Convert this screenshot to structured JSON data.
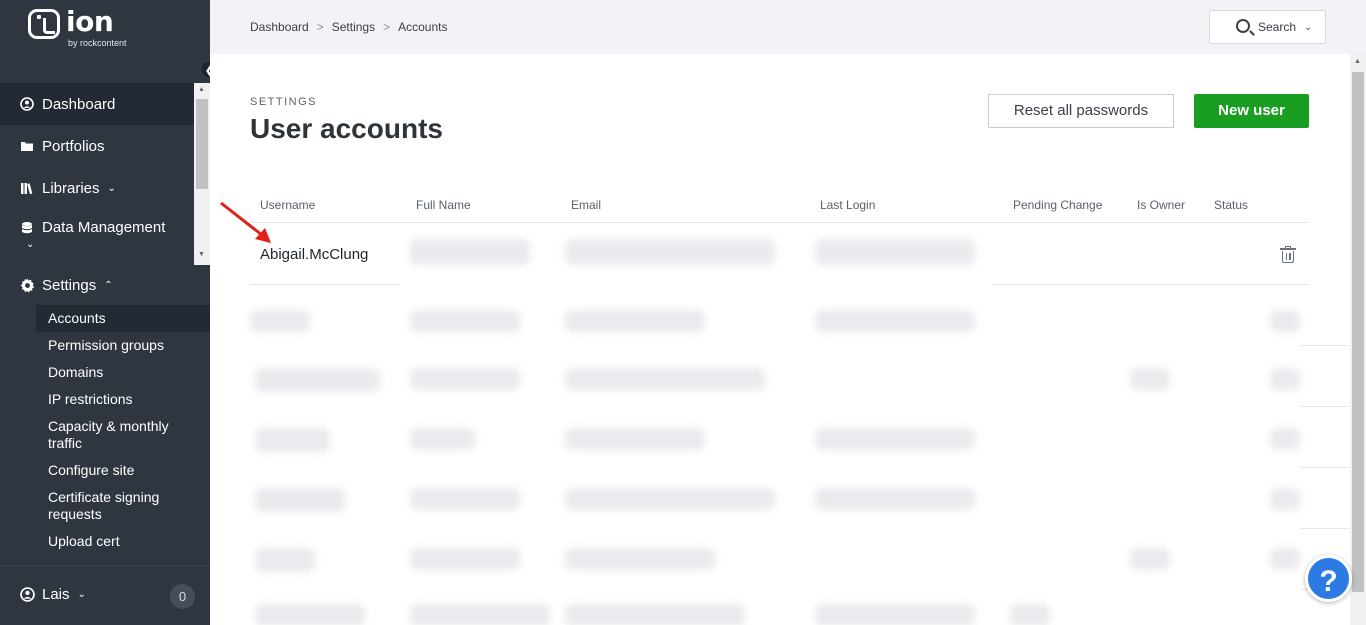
{
  "brand": {
    "name": "ion",
    "byline": "by rockcontent"
  },
  "sidebar": {
    "items": [
      {
        "label": "Dashboard",
        "icon": "user-circle-icon"
      },
      {
        "label": "Portfolios",
        "icon": "folder-icon"
      },
      {
        "label": "Libraries",
        "icon": "books-icon"
      },
      {
        "label": "Data Management",
        "icon": "database-icon"
      }
    ],
    "settings": {
      "label": "Settings",
      "sub_items": [
        "Accounts",
        "Permission groups",
        "Domains",
        "IP restrictions",
        "Capacity & monthly traffic",
        "Configure site",
        "Certificate signing requests",
        "Upload cert"
      ]
    },
    "user": {
      "name": "Lais",
      "notifications": "0"
    }
  },
  "topbar": {
    "breadcrumb": [
      "Dashboard",
      "Settings",
      "Accounts"
    ],
    "search_label": "Search"
  },
  "main": {
    "section_label": "SETTINGS",
    "title": "User accounts",
    "reset_label": "Reset all passwords",
    "new_user_label": "New user",
    "table": {
      "headers": [
        "Username",
        "Full Name",
        "Email",
        "Last Login",
        "Pending Change",
        "Is Owner",
        "Status"
      ],
      "rows": [
        {
          "username": "Abigail.McClung"
        }
      ]
    }
  },
  "help": {
    "label": "?"
  },
  "colors": {
    "sidebar": "#2f3640",
    "primary_button": "#1a9e22",
    "help_button": "#2c7be5",
    "annotation_arrow": "#e0201b"
  }
}
